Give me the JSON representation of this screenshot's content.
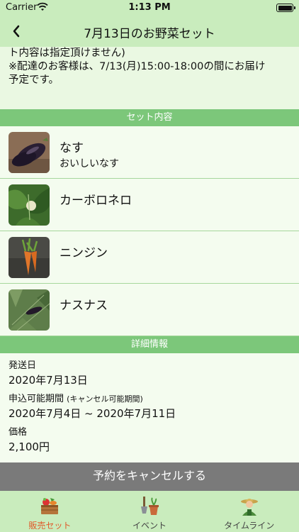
{
  "status_bar": {
    "carrier": "Carrier",
    "time": "1:13 PM"
  },
  "nav": {
    "title": "7月13日のお野菜セット"
  },
  "notice": {
    "lines": [
      "ト内容は指定頂けません)",
      "※配達のお客様は、7/13(月)15:00-18:00の間にお届け",
      "予定です。"
    ]
  },
  "set_section": {
    "header": "セット内容",
    "items": [
      {
        "name": "なす",
        "description": "おいしいなす",
        "icon": "eggplant-photo"
      },
      {
        "name": "カーボロネロ",
        "description": "",
        "icon": "cavolo-nero-photo"
      },
      {
        "name": "ニンジン",
        "description": "",
        "icon": "carrot-photo"
      },
      {
        "name": "ナスナス",
        "description": "",
        "icon": "nasunasu-photo"
      }
    ]
  },
  "details": {
    "header": "詳細情報",
    "ship_date_label": "発送日",
    "ship_date_value": "2020年7月13日",
    "apply_period_label": "申込可能期間",
    "apply_period_note": "(キャンセル可能期間)",
    "apply_period_value": "2020年7月4日 ~ 2020年7月11日",
    "price_label": "価格",
    "price_value": "2,100円"
  },
  "cancel_button": {
    "label": "予約をキャンセルする"
  },
  "tabs": [
    {
      "label": "販売セット",
      "icon": "vegetable-crate-icon",
      "active": true
    },
    {
      "label": "イベント",
      "icon": "shovel-pot-icon",
      "active": false
    },
    {
      "label": "タイムライン",
      "icon": "farmer-icon",
      "active": false
    }
  ],
  "colors": {
    "bar_green": "#c9ecbd",
    "header_green": "#7cc77a",
    "background": "#eaf8e2",
    "active_tab": "#e05a2b",
    "cancel_gray": "#7a7a7a"
  }
}
